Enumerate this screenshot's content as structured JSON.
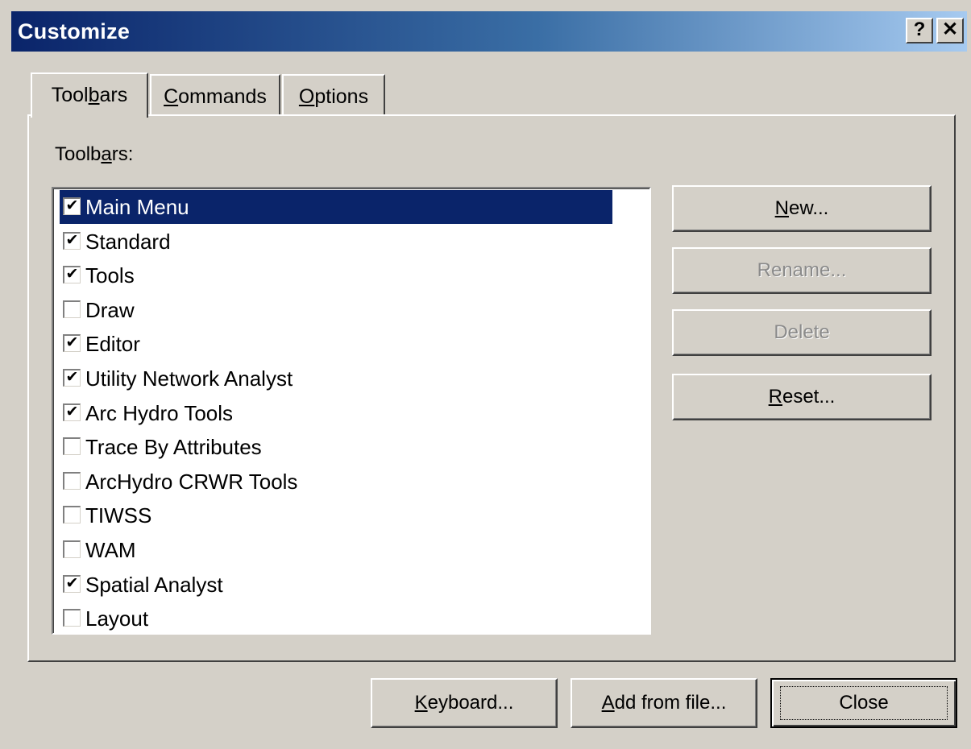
{
  "window": {
    "title": "Customize",
    "help_button": "?",
    "close_button": "✕"
  },
  "tabs": [
    {
      "pre": "Tool",
      "mnemonic": "b",
      "post": "ars",
      "selected": true
    },
    {
      "pre": "",
      "mnemonic": "C",
      "post": "ommands",
      "selected": false
    },
    {
      "pre": "",
      "mnemonic": "O",
      "post": "ptions",
      "selected": false
    }
  ],
  "toolbars_section": {
    "label_pre": "Toolb",
    "label_mnemonic": "a",
    "label_post": "rs:",
    "items": [
      {
        "label": "Main Menu",
        "checked": true,
        "selected": true
      },
      {
        "label": "Standard",
        "checked": true,
        "selected": false
      },
      {
        "label": "Tools",
        "checked": true,
        "selected": false
      },
      {
        "label": "Draw",
        "checked": false,
        "selected": false
      },
      {
        "label": "Editor",
        "checked": true,
        "selected": false
      },
      {
        "label": "Utility Network Analyst",
        "checked": true,
        "selected": false
      },
      {
        "label": "Arc Hydro Tools",
        "checked": true,
        "selected": false
      },
      {
        "label": "Trace By Attributes",
        "checked": false,
        "selected": false
      },
      {
        "label": "ArcHydro CRWR Tools",
        "checked": false,
        "selected": false
      },
      {
        "label": "TIWSS",
        "checked": false,
        "selected": false
      },
      {
        "label": "WAM",
        "checked": false,
        "selected": false
      },
      {
        "label": "Spatial Analyst",
        "checked": true,
        "selected": false
      },
      {
        "label": "Layout",
        "checked": false,
        "selected": false
      }
    ],
    "check_glyph": "✔",
    "scroll_up_glyph": "▲",
    "scroll_down_glyph": "▼"
  },
  "side_buttons": {
    "new": {
      "mnemonic": "N",
      "post": "ew..."
    },
    "rename": {
      "label": "Rename..."
    },
    "delete": {
      "label": "Delete"
    },
    "reset": {
      "mnemonic": "R",
      "post": "eset..."
    }
  },
  "bottom_buttons": {
    "keyboard": {
      "mnemonic": "K",
      "post": "eyboard..."
    },
    "add_from_file": {
      "mnemonic": "A",
      "post": "dd from file..."
    },
    "close": {
      "label": "Close"
    }
  }
}
